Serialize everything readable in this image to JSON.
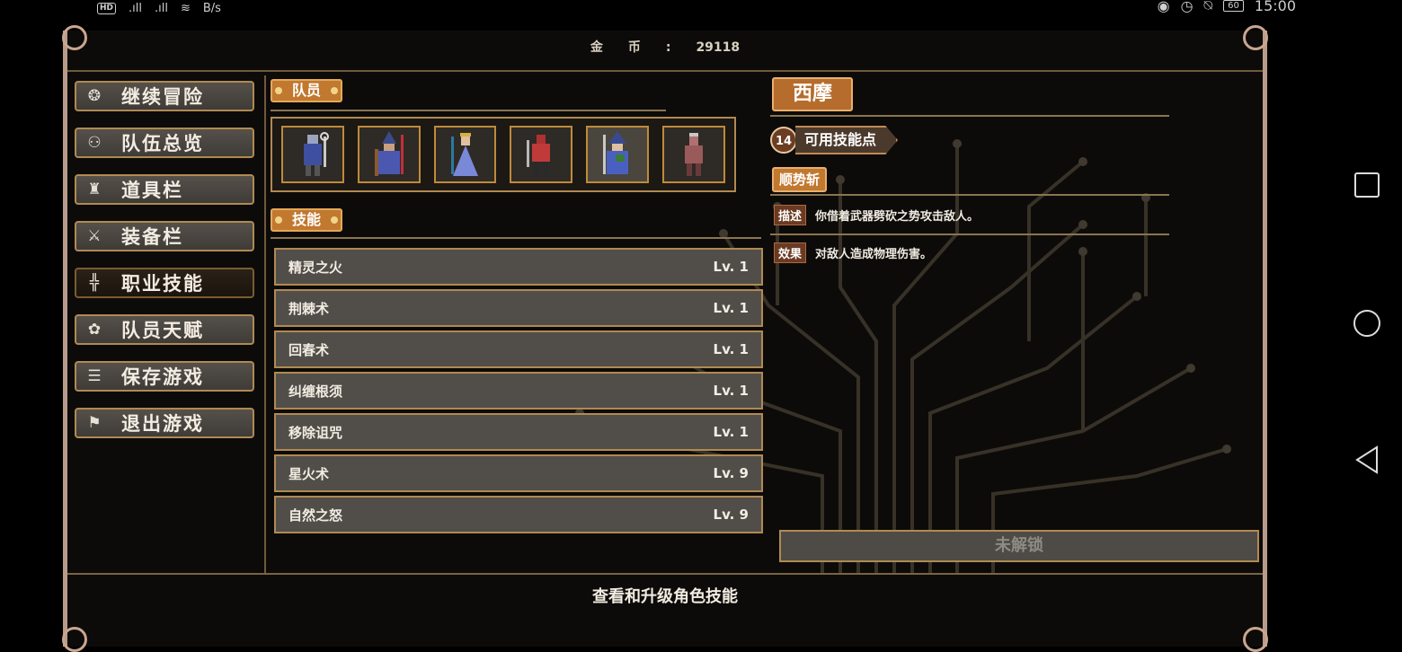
{
  "status_bar": {
    "network": "B/s",
    "hd_label": "HD",
    "battery": "60",
    "time": "15:00"
  },
  "header": {
    "gold_label": "金币:",
    "gold_value": "29118"
  },
  "menu": [
    {
      "label": "继续冒险",
      "icon": "dragon-crest-icon"
    },
    {
      "label": "队伍总览",
      "icon": "party-icon"
    },
    {
      "label": "道具栏",
      "icon": "bag-icon"
    },
    {
      "label": "装备栏",
      "icon": "equipment-icon"
    },
    {
      "label": "职业技能",
      "icon": "winged-sword-icon",
      "active": true
    },
    {
      "label": "队员天赋",
      "icon": "laurel-icon"
    },
    {
      "label": "保存游戏",
      "icon": "scroll-icon"
    },
    {
      "label": "退出游戏",
      "icon": "flag-icon"
    }
  ],
  "party": {
    "label": "队员",
    "members": [
      "knight-mace",
      "mage-staff",
      "priestess",
      "red-warrior",
      "wizard-blue",
      "barbarian"
    ],
    "selected_index": 4
  },
  "skills": {
    "label": "技能",
    "items": [
      {
        "name": "精灵之火",
        "level": "Lv. 1"
      },
      {
        "name": "荆棘术",
        "level": "Lv. 1"
      },
      {
        "name": "回春术",
        "level": "Lv. 1"
      },
      {
        "name": "纠缠根须",
        "level": "Lv. 1"
      },
      {
        "name": "移除诅咒",
        "level": "Lv. 1"
      },
      {
        "name": "星火术",
        "level": "Lv. 9"
      },
      {
        "name": "自然之怒",
        "level": "Lv. 9"
      }
    ]
  },
  "character": {
    "name": "西摩",
    "skill_points": "14",
    "skill_points_label": "可用技能点",
    "selected_skill": "顺势斩",
    "desc_tag": "描述",
    "description": "你借着武器劈砍之势攻击敌人。",
    "effect_tag": "效果",
    "effect": "对敌人造成物理伤害。",
    "lock_button": "未解锁"
  },
  "footer": {
    "hint": "查看和升级角色技能"
  },
  "colors": {
    "accent": "#c1782f",
    "frame": "#b08a52",
    "row_bg": "#514e4a"
  }
}
